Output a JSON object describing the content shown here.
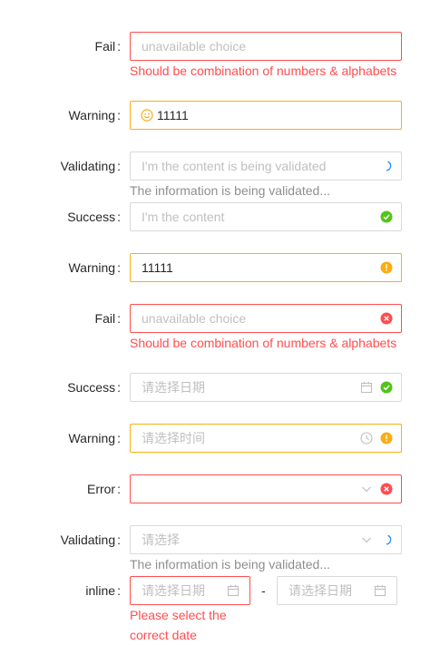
{
  "colors": {
    "error": "#ff4d4f",
    "warning": "#faad14",
    "success": "#52c41a",
    "validating": "#1890ff"
  },
  "rows": [
    {
      "label": "Fail",
      "placeholder": "unavailable choice",
      "explain": "Should be combination of numbers & alphabets"
    },
    {
      "label": "Warning",
      "value": "11111",
      "prefix_icon": "smile-icon"
    },
    {
      "label": "Validating",
      "placeholder": "I'm the content is being validated",
      "explain": "The information is being validated..."
    },
    {
      "label": "Success",
      "placeholder": "I'm the content"
    },
    {
      "label": "Warning",
      "value": "11111"
    },
    {
      "label": "Fail",
      "placeholder": "unavailable choice",
      "explain": "Should be combination of numbers & alphabets"
    },
    {
      "label": "Success",
      "placeholder": "请选择日期"
    },
    {
      "label": "Warning",
      "placeholder": "请选择时间"
    },
    {
      "label": "Error",
      "placeholder": ""
    },
    {
      "label": "Validating",
      "placeholder": "请选择",
      "explain": "The information is being validated..."
    },
    {
      "label": "inline",
      "start_placeholder": "请选择日期",
      "separator": "-",
      "end_placeholder": "请选择日期",
      "explain": "Please select the correct date"
    }
  ],
  "colon": ":"
}
